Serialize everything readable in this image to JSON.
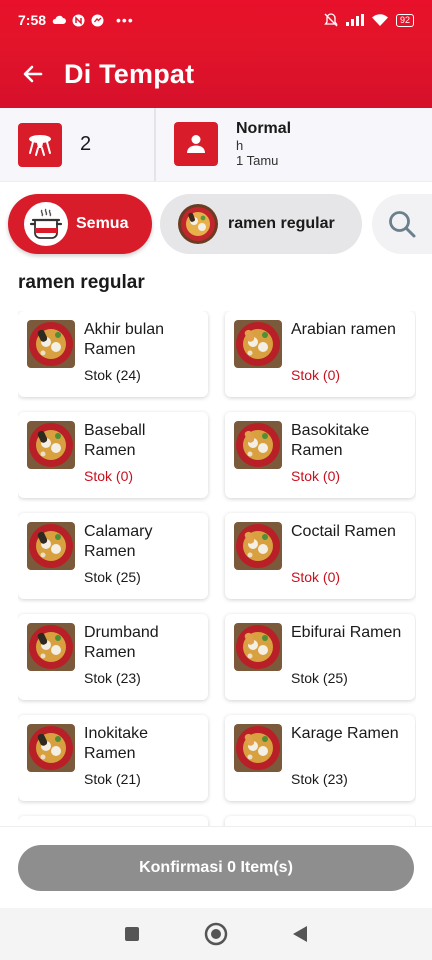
{
  "status_bar": {
    "time": "7:58",
    "left_icons": [
      "cloud-icon",
      "notification-n-icon",
      "messenger-icon",
      "more-dots-icon"
    ],
    "right_icons": [
      "mute-bell-icon",
      "signal-icon",
      "wifi-icon",
      "battery-icon"
    ],
    "battery": "92"
  },
  "app_bar": {
    "title": "Di Tempat",
    "back_icon": "arrow-left-icon"
  },
  "info": {
    "table_icon": "table-icon",
    "table_count": "2",
    "guest_icon": "person-icon",
    "guest_type": "Normal",
    "guest_note": "h",
    "guest_count": "1 Tamu"
  },
  "categories": [
    {
      "label": "Semua",
      "icon": "pot-icon",
      "active": true
    },
    {
      "label": "ramen regular",
      "icon": "ramen-bowl-image",
      "active": false
    }
  ],
  "search_icon": "search-icon",
  "section_title": "ramen regular",
  "menu_items": [
    {
      "name": "Akhir bulan Ramen",
      "stock": "Stok (24)",
      "out": false
    },
    {
      "name": "Arabian ramen",
      "stock": "Stok (0)",
      "out": true
    },
    {
      "name": "Baseball Ramen",
      "stock": "Stok (0)",
      "out": true
    },
    {
      "name": "Basokitake Ramen",
      "stock": "Stok (0)",
      "out": true
    },
    {
      "name": "Calamary Ramen",
      "stock": "Stok (25)",
      "out": false
    },
    {
      "name": "Coctail Ramen",
      "stock": "Stok (0)",
      "out": true
    },
    {
      "name": "Drumband Ramen",
      "stock": "Stok (23)",
      "out": false
    },
    {
      "name": "Ebifurai Ramen",
      "stock": "Stok (25)",
      "out": false
    },
    {
      "name": "Inokitake Ramen",
      "stock": "Stok (21)",
      "out": false
    },
    {
      "name": "Karage Ramen",
      "stock": "Stok (23)",
      "out": false
    }
  ],
  "confirm_button": "Konfirmasi 0 Item(s)",
  "nav_bar": {
    "icons": [
      "square-recent-icon",
      "circle-home-icon",
      "triangle-back-icon"
    ]
  },
  "colors": {
    "brand_red": "#d81c2a",
    "out_of_stock": "#c8101e",
    "button_disabled": "#8e8e8e"
  }
}
